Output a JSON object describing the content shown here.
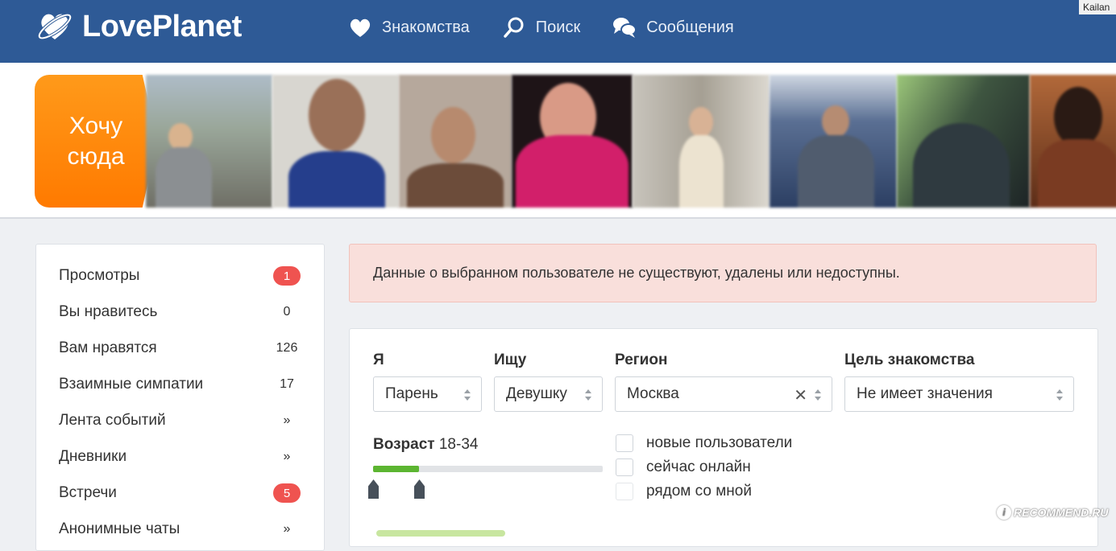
{
  "header": {
    "logo_text": "LovePlanet",
    "nav": [
      {
        "label": "Знакомства",
        "icon": "heart-icon"
      },
      {
        "label": "Поиск",
        "icon": "search-icon"
      },
      {
        "label": "Сообщения",
        "icon": "chat-bubbles-icon"
      }
    ],
    "corner_user": "Kailan"
  },
  "banner": {
    "want_here": "Хочу сюда"
  },
  "sidebar": {
    "items": [
      {
        "label": "Просмотры",
        "value": "1",
        "style": "badge"
      },
      {
        "label": "Вы нравитесь",
        "value": "0",
        "style": "count"
      },
      {
        "label": "Вам нравятся",
        "value": "126",
        "style": "count"
      },
      {
        "label": "Взаимные симпатии",
        "value": "17",
        "style": "count"
      },
      {
        "label": "Лента событий",
        "value": "»",
        "style": "count"
      },
      {
        "label": "Дневники",
        "value": "»",
        "style": "count"
      },
      {
        "label": "Встречи",
        "value": "5",
        "style": "badge"
      },
      {
        "label": "Анонимные чаты",
        "value": "»",
        "style": "count"
      }
    ]
  },
  "alert": {
    "text": "Данные о выбранном пользователе не существуют, удалены или недоступны."
  },
  "search": {
    "i_label": "Я",
    "i_value": "Парень",
    "seek_label": "Ищу",
    "seek_value": "Девушку",
    "region_label": "Регион",
    "region_value": "Москва",
    "goal_label": "Цель знакомства",
    "goal_value": "Не имеет значения",
    "age_label": "Возраст",
    "age_value": "18-34",
    "age_range_fraction": [
      0.0,
      0.2
    ],
    "checkboxes": [
      {
        "label": "новые пользователи",
        "checked": false
      },
      {
        "label": "сейчас онлайн",
        "checked": false
      },
      {
        "label": "рядом со мной",
        "checked": false
      }
    ]
  },
  "watermark": {
    "text": "RECOMMEND.RU"
  },
  "colors": {
    "header_bg": "#2e5a96",
    "accent_orange": "#ff8a0d",
    "badge_red": "#ef5350",
    "slider_green": "#5cb531",
    "alert_bg": "#f9dfdb"
  }
}
